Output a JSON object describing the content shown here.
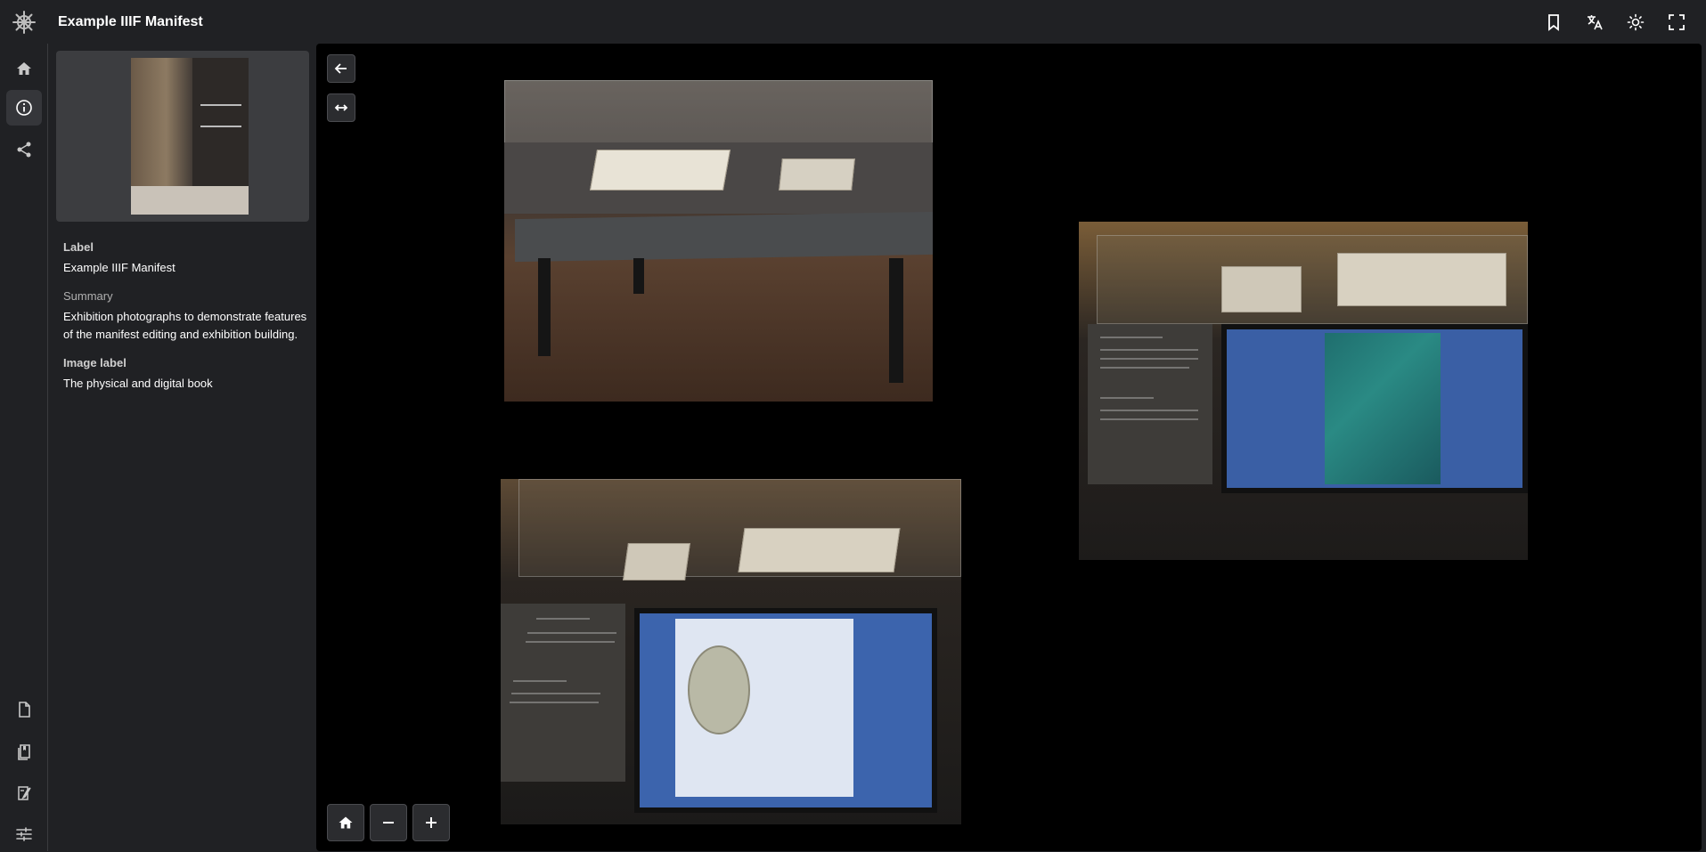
{
  "header": {
    "title": "Example IIIF Manifest",
    "actions": [
      {
        "name": "bookmark-icon"
      },
      {
        "name": "translate-icon"
      },
      {
        "name": "theme-sun-icon"
      },
      {
        "name": "fullscreen-icon"
      }
    ]
  },
  "rail": {
    "top_items": [
      {
        "name": "home-icon"
      },
      {
        "name": "info-icon",
        "active": true
      },
      {
        "name": "share-icon"
      }
    ],
    "bottom_items": [
      {
        "name": "document-icon"
      },
      {
        "name": "bookmark-list-icon"
      },
      {
        "name": "notes-icon"
      },
      {
        "name": "settings-sliders-icon"
      }
    ]
  },
  "info_panel": {
    "label_heading": "Label",
    "label_value": "Example IIIF Manifest",
    "summary_heading": "Summary",
    "summary_value": "Exhibition photographs to demonstrate features of the manifest editing and exhibition building.",
    "image_label_heading": "Image label",
    "image_label_value": "The physical and digital book"
  },
  "viewer": {
    "controls": [
      "back-arrow-icon",
      "fit-width-icon"
    ],
    "zoom": [
      "home-icon",
      "zoom-out-icon",
      "zoom-in-icon"
    ],
    "images": [
      {
        "description_name": "exhibition-photo-display-case"
      },
      {
        "description_name": "exhibition-photo-bayard-album-screen"
      },
      {
        "description_name": "exhibition-photo-photographie-screen"
      }
    ]
  },
  "colors": {
    "background": "#202124",
    "viewer_bg": "#000000",
    "active_rail": "#35363a",
    "text": "#ffffff",
    "muted": "#b0b0b0"
  }
}
